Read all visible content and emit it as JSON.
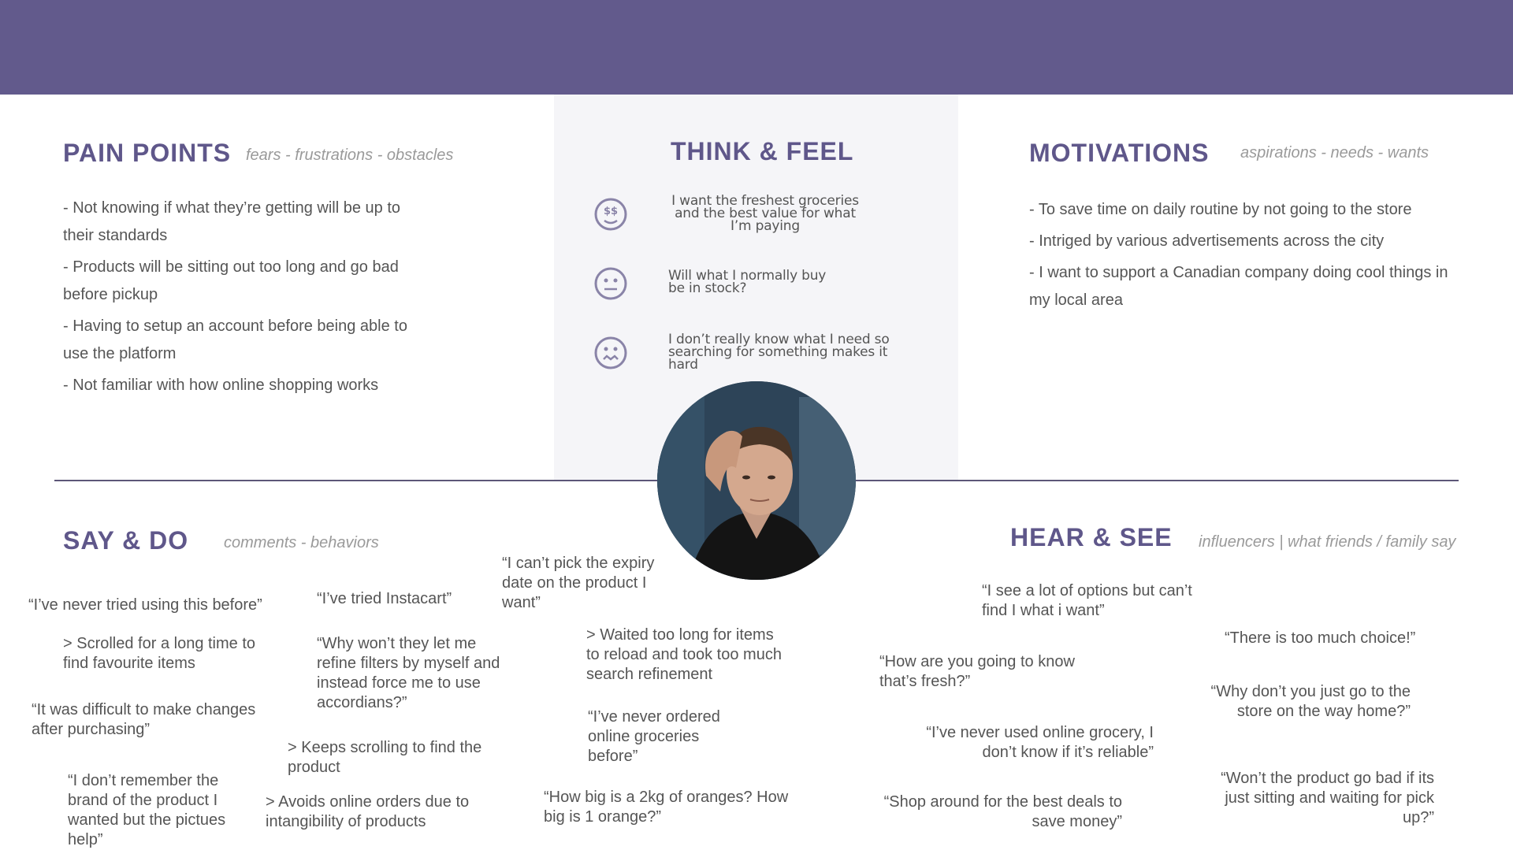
{
  "pain_points": {
    "title": "PAIN POINTS",
    "subtitle": "fears - frustrations - obstacles",
    "items": [
      "- Not knowing if what they’re getting will be up to their standards",
      "- Products will be sitting out too long and go bad before pickup",
      "- Having to setup an account before being able to use the platform",
      "- Not familiar with how online shopping works"
    ]
  },
  "think_feel": {
    "title": "THINK & FEEL",
    "items": [
      {
        "icon": "money-eyes-face-icon",
        "text": "I want the freshest groceries\nand the best value for what\nI’m paying"
      },
      {
        "icon": "neutral-face-icon",
        "text": "Will what I normally buy\nbe in stock?"
      },
      {
        "icon": "worried-face-icon",
        "text": "I don’t really know what I need so\nsearching for something makes it\nhard"
      }
    ]
  },
  "motivations": {
    "title": "MOTIVATIONS",
    "subtitle": "aspirations - needs - wants",
    "items": [
      "- To save time on daily routine by not going to the store",
      "- Intriged by various advertisements across the city",
      "- I want to support a Canadian company doing cool things in my local area"
    ]
  },
  "say_do": {
    "title": "SAY & DO",
    "subtitle": "comments - behaviors",
    "quotes": [
      "“I’ve never tried using this before”",
      "> Scrolled for a long time to\nfind favourite items",
      "“It was difficult to make changes\nafter purchasing”",
      "“I don’t remember the\nbrand of the product I\nwanted but the pictues\nhelp”",
      "“I’ve tried Instacart”",
      "“Why won’t they let me\nrefine filters by myself and\ninstead force me to use\naccordians?”",
      "> Keeps scrolling to find the\nproduct",
      "> Avoids online orders due to\nintangibility of products",
      "“I can’t pick the expiry\ndate on the product I\nwant”",
      "> Waited too long for items\nto reload and took too much\nsearch refinement",
      "“I’ve never ordered\nonline groceries\nbefore”",
      "“How big is a 2kg of oranges? How\nbig is 1 orange?”"
    ]
  },
  "hear_see": {
    "title": "HEAR & SEE",
    "subtitle": "influencers | what friends / family say",
    "quotes": [
      "“I see a lot of options but can’t\nfind I  what i want”",
      "“How are you going to know\nthat’s fresh?”",
      "“I’ve never used online grocery, I\ndon’t know if it’s reliable”",
      "“Shop around for the best deals to\nsave money”",
      "“There is too much choice!”",
      "“Why don’t you just go to the\nstore on the way home?”",
      "“Won’t the product go bad if its\njust sitting and waiting for pick\nup?”"
    ]
  },
  "colors": {
    "banner": "#625a8c",
    "heading": "#5f578a",
    "panel": "#f5f5f8",
    "divider": "#5c5678"
  }
}
